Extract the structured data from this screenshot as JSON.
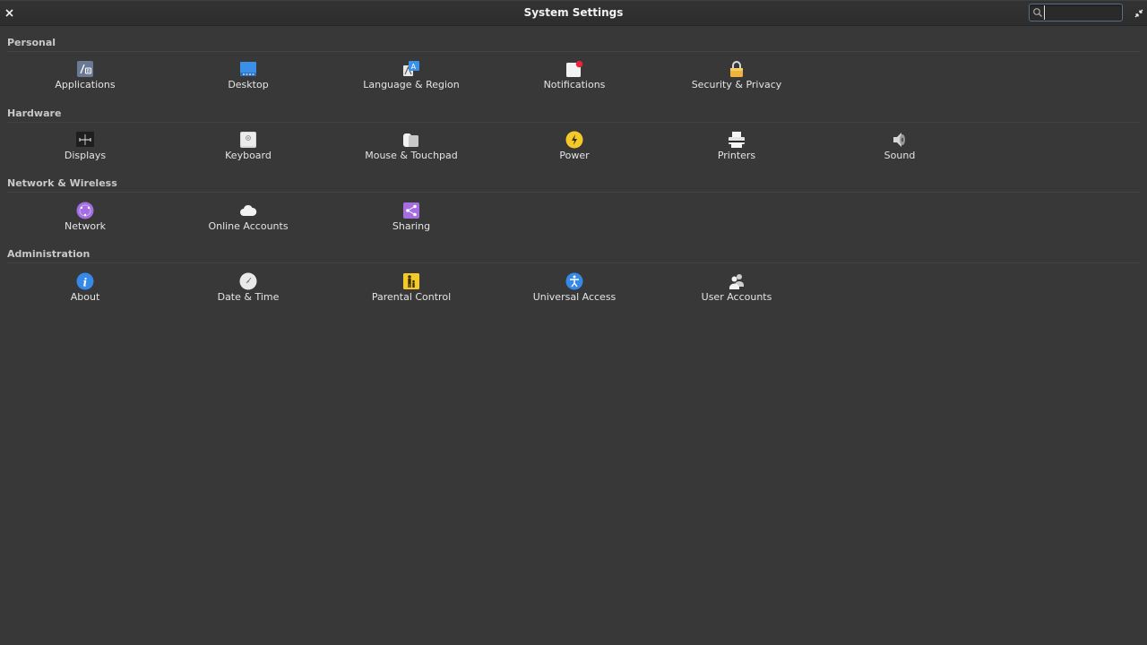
{
  "window": {
    "title": "System Settings",
    "search": {
      "value": "",
      "placeholder": ""
    }
  },
  "sections": [
    {
      "title": "Personal",
      "items": [
        {
          "label": "Applications",
          "icon": "applications-icon"
        },
        {
          "label": "Desktop",
          "icon": "desktop-icon"
        },
        {
          "label": "Language & Region",
          "icon": "language-icon"
        },
        {
          "label": "Notifications",
          "icon": "notifications-icon"
        },
        {
          "label": "Security & Privacy",
          "icon": "lock-icon"
        }
      ]
    },
    {
      "title": "Hardware",
      "items": [
        {
          "label": "Displays",
          "icon": "displays-icon"
        },
        {
          "label": "Keyboard",
          "icon": "keyboard-icon"
        },
        {
          "label": "Mouse & Touchpad",
          "icon": "mouse-icon"
        },
        {
          "label": "Power",
          "icon": "power-icon"
        },
        {
          "label": "Printers",
          "icon": "printer-icon"
        },
        {
          "label": "Sound",
          "icon": "speaker-icon"
        }
      ]
    },
    {
      "title": "Network & Wireless",
      "items": [
        {
          "label": "Network",
          "icon": "network-icon"
        },
        {
          "label": "Online Accounts",
          "icon": "cloud-icon"
        },
        {
          "label": "Sharing",
          "icon": "share-icon"
        }
      ]
    },
    {
      "title": "Administration",
      "items": [
        {
          "label": "About",
          "icon": "info-icon"
        },
        {
          "label": "Date & Time",
          "icon": "clock-icon"
        },
        {
          "label": "Parental Control",
          "icon": "parental-control-icon"
        },
        {
          "label": "Universal Access",
          "icon": "accessibility-icon"
        },
        {
          "label": "User Accounts",
          "icon": "users-icon"
        }
      ]
    }
  ]
}
